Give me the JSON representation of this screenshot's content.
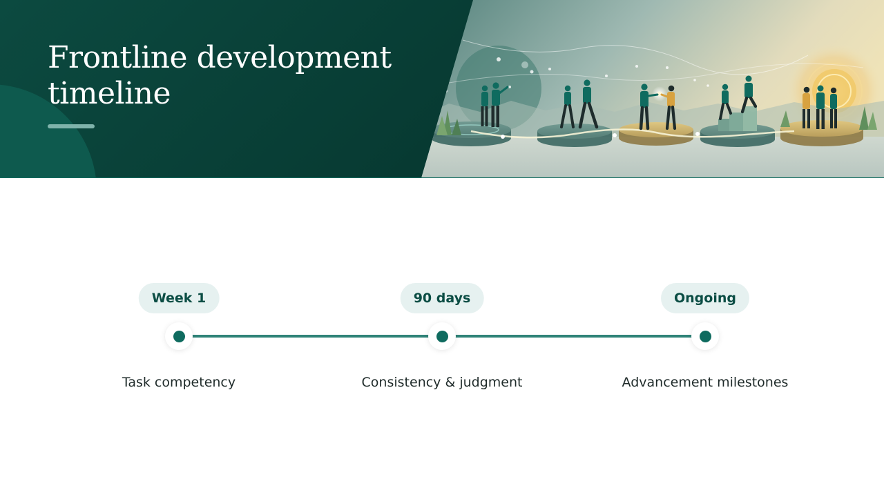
{
  "header": {
    "title": "Frontline development timeline",
    "background_color": "#073a32",
    "accent_color": "#0f6b5f"
  },
  "timeline": {
    "milestones": [
      {
        "label": "Week 1",
        "description": "Task competency"
      },
      {
        "label": "90 days",
        "description": "Consistency & judgment"
      },
      {
        "label": "Ongoing",
        "description": "Advancement milestones"
      }
    ]
  }
}
